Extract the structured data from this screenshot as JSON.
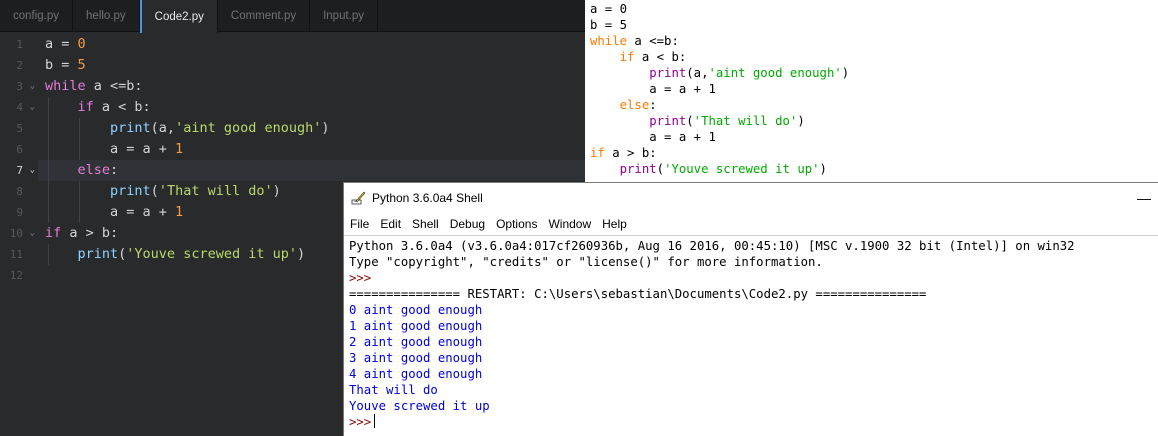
{
  "editor": {
    "tabs": [
      {
        "label": "config.py",
        "active": false
      },
      {
        "label": "hello.py",
        "active": false
      },
      {
        "label": "Code2.py",
        "active": true
      },
      {
        "label": "Comment.py",
        "active": false
      },
      {
        "label": "Input.py",
        "active": false
      }
    ],
    "line_numbers": [
      "1",
      "2",
      "3",
      "4",
      "5",
      "6",
      "7",
      "8",
      "9",
      "10",
      "11",
      "12"
    ],
    "current_line": "7",
    "code": [
      {
        "ln": "1",
        "tokens": [
          {
            "t": "a = ",
            "c": "op"
          },
          {
            "t": "0",
            "c": "nm"
          }
        ]
      },
      {
        "ln": "2",
        "tokens": [
          {
            "t": "b = ",
            "c": "op"
          },
          {
            "t": "5",
            "c": "nm"
          }
        ]
      },
      {
        "ln": "3",
        "tokens": [
          {
            "t": "while",
            "c": "kw"
          },
          {
            "t": " a <=b:",
            "c": "op"
          }
        ]
      },
      {
        "ln": "4",
        "tokens": [
          {
            "t": "    ",
            "c": "op"
          },
          {
            "t": "if",
            "c": "kw"
          },
          {
            "t": " a < b:",
            "c": "op"
          }
        ]
      },
      {
        "ln": "5",
        "tokens": [
          {
            "t": "        ",
            "c": "op"
          },
          {
            "t": "print",
            "c": "fn"
          },
          {
            "t": "(a,",
            "c": "op"
          },
          {
            "t": "'aint good enough'",
            "c": "st"
          },
          {
            "t": ")",
            "c": "op"
          }
        ]
      },
      {
        "ln": "6",
        "tokens": [
          {
            "t": "        a = a + ",
            "c": "op"
          },
          {
            "t": "1",
            "c": "nm"
          }
        ]
      },
      {
        "ln": "7",
        "tokens": [
          {
            "t": "    ",
            "c": "op"
          },
          {
            "t": "else",
            "c": "kw"
          },
          {
            "t": ":",
            "c": "op"
          }
        ]
      },
      {
        "ln": "8",
        "tokens": [
          {
            "t": "        ",
            "c": "op"
          },
          {
            "t": "print",
            "c": "fn"
          },
          {
            "t": "(",
            "c": "op"
          },
          {
            "t": "'That will do'",
            "c": "st"
          },
          {
            "t": ")",
            "c": "op"
          }
        ]
      },
      {
        "ln": "9",
        "tokens": [
          {
            "t": "        a = a + ",
            "c": "op"
          },
          {
            "t": "1",
            "c": "nm"
          }
        ]
      },
      {
        "ln": "10",
        "tokens": [
          {
            "t": "if",
            "c": "kw"
          },
          {
            "t": " a > b:",
            "c": "op"
          }
        ]
      },
      {
        "ln": "11",
        "tokens": [
          {
            "t": "    ",
            "c": "op"
          },
          {
            "t": "print",
            "c": "fn"
          },
          {
            "t": "(",
            "c": "op"
          },
          {
            "t": "'Youve screwed it up'",
            "c": "st"
          },
          {
            "t": ")",
            "c": "op"
          }
        ]
      },
      {
        "ln": "12",
        "tokens": []
      }
    ],
    "fold_markers": [
      "3",
      "4",
      "7",
      "10"
    ],
    "colors": {
      "background": "#282a2c",
      "keyword": "#e77cd8",
      "function": "#8fd2ff",
      "number": "#f49b45",
      "string": "#b9d96a",
      "active_tab_accent": "#4d94dc"
    }
  },
  "listing": {
    "lines": [
      [
        {
          "t": "a = 0",
          "c": "n"
        }
      ],
      [
        {
          "t": "b = 5",
          "c": "n"
        }
      ],
      [
        {
          "t": "while",
          "c": "k"
        },
        {
          "t": " a <=b:",
          "c": "n"
        }
      ],
      [
        {
          "t": "    ",
          "c": "n"
        },
        {
          "t": "if",
          "c": "k"
        },
        {
          "t": " a < b:",
          "c": "n"
        }
      ],
      [
        {
          "t": "        ",
          "c": "n"
        },
        {
          "t": "print",
          "c": "b"
        },
        {
          "t": "(a,",
          "c": "n"
        },
        {
          "t": "'aint good enough'",
          "c": "s"
        },
        {
          "t": ")",
          "c": "n"
        }
      ],
      [
        {
          "t": "        a = a + 1",
          "c": "n"
        }
      ],
      [
        {
          "t": "    ",
          "c": "n"
        },
        {
          "t": "else",
          "c": "k"
        },
        {
          "t": ":",
          "c": "n"
        }
      ],
      [
        {
          "t": "        ",
          "c": "n"
        },
        {
          "t": "print",
          "c": "b"
        },
        {
          "t": "(",
          "c": "n"
        },
        {
          "t": "'That will do'",
          "c": "s"
        },
        {
          "t": ")",
          "c": "n"
        }
      ],
      [
        {
          "t": "        a = a + 1",
          "c": "n"
        }
      ],
      [
        {
          "t": "if",
          "c": "k"
        },
        {
          "t": " a > b:",
          "c": "n"
        }
      ],
      [
        {
          "t": "    ",
          "c": "n"
        },
        {
          "t": "print",
          "c": "b"
        },
        {
          "t": "(",
          "c": "n"
        },
        {
          "t": "'Youve screwed it up'",
          "c": "s"
        },
        {
          "t": ")",
          "c": "n"
        }
      ]
    ]
  },
  "shell": {
    "title": "Python 3.6.0a4 Shell",
    "minimize_label": "—",
    "menu": [
      "File",
      "Edit",
      "Shell",
      "Debug",
      "Options",
      "Window",
      "Help"
    ],
    "lines": [
      {
        "text": "Python 3.6.0a4 (v3.6.0a4:017cf260936b, Aug 16 2016, 00:45:10) [MSC v.1900 32 bit (Intel)] on win32",
        "kind": "info"
      },
      {
        "text": "Type \"copyright\", \"credits\" or \"license()\" for more information.",
        "kind": "info"
      },
      {
        "text": ">>> ",
        "kind": "prompt"
      },
      {
        "text": "=============== RESTART: C:\\Users\\sebastian\\Documents\\Code2.py ===============",
        "kind": "info"
      },
      {
        "text": "0 aint good enough",
        "kind": "out"
      },
      {
        "text": "1 aint good enough",
        "kind": "out"
      },
      {
        "text": "2 aint good enough",
        "kind": "out"
      },
      {
        "text": "3 aint good enough",
        "kind": "out"
      },
      {
        "text": "4 aint good enough",
        "kind": "out"
      },
      {
        "text": "That will do",
        "kind": "out"
      },
      {
        "text": "Youve screwed it up",
        "kind": "out"
      }
    ],
    "final_prompt": ">>>",
    "title_icon": "python-feather-icon"
  }
}
